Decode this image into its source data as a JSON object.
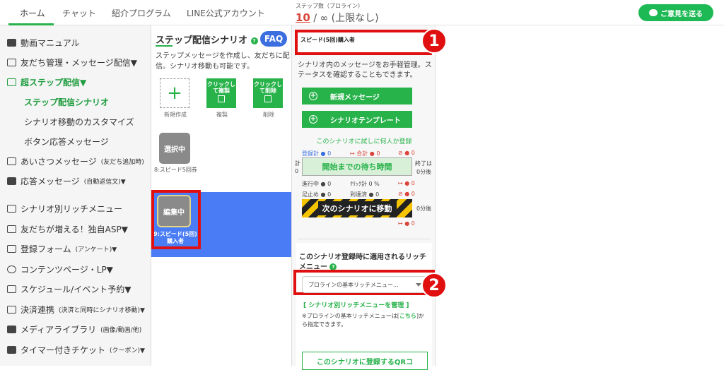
{
  "topnav": {
    "tabs": [
      "ホーム",
      "チャット",
      "紹介プログラム",
      "LINE公式アカウント"
    ],
    "steps_label": "ステップ数（プロライン）",
    "steps_current": "10",
    "steps_rest": "/ ∞ (上限なし)",
    "feedback_label": "ご意見を送る"
  },
  "sidebar": {
    "items": [
      {
        "label": "動画マニュアル"
      },
      {
        "label": "友だち管理・メッセージ配信▼"
      },
      {
        "label": "超ステップ配信▼"
      },
      {
        "label": "ステップ配信シナリオ"
      },
      {
        "label": "シナリオ移動のカスタマイズ"
      },
      {
        "label": "ボタン応答メッセージ"
      },
      {
        "label": "あいさつメッセージ",
        "note": "(友だち追加時)"
      },
      {
        "label": "応答メッセージ",
        "note": "(自動返信文)▼"
      },
      {
        "label": "シナリオ別リッチメニュー"
      },
      {
        "label": "友だちが増える！独自ASP▼"
      },
      {
        "label": "登録フォーム",
        "note": "(アンケート)▼"
      },
      {
        "label": "コンテンツページ・LP▼"
      },
      {
        "label": "スケジュール/イベント予約▼"
      },
      {
        "label": "決済連携",
        "note": "(決済と同時にシナリオ移動)▼"
      },
      {
        "label": "メディアライブラリ",
        "note": "(画像/動画/他)"
      },
      {
        "label": "タイマー付きチケット",
        "note": "(クーポン)▼"
      }
    ]
  },
  "scenario_panel": {
    "title": "ステップ配信シナリオ",
    "help": "?",
    "faq": "FAQ",
    "description": "ステップメッセージを作成し、友だちに配信。シナリオ移動も可能です。",
    "new_caption": "新規作成",
    "copy_btn": "クリックして複製",
    "copy_caption": "複製",
    "delete_btn": "クリックして削除",
    "delete_caption": "削除",
    "tile1_label": "選択中",
    "tile1_caption": "8:スピード5回券",
    "tile2_label": "編集中",
    "tile2_caption": "9:スピード(5回)購入者"
  },
  "detail_panel": {
    "scenario_name": "スピード(5回)購入者",
    "description": "シナリオ内のメッセージをお手軽管理。ステータスを確認することもできます。",
    "new_message": "新規メッセージ",
    "template": "シナリオテンプレート",
    "trial": "このシナリオに試しに何人か登録",
    "stats": {
      "registered": "登録計",
      "total": "合計",
      "count0": "0",
      "in_progress": "進行中",
      "click_total": "ｸﾘｯｸ計",
      "click_pct": "0 %",
      "stopped": "足止め",
      "reached": "到達済",
      "total_left": "計",
      "zero": "0",
      "end_label": "終了は",
      "after0": "0分後",
      "after0b": "0分後"
    },
    "wait_label": "開始までの待ち時間",
    "next_label": "次のシナリオに移動",
    "richmenu_title": "このシナリオ登録時に適用されるリッチメニュー",
    "richmenu_help": "?",
    "richmenu_select": "プロラインの基本リッチメニュー...",
    "manage_link": "[ シナリオ別リッチメニューを管理 ]",
    "note_prefix": "※プロラインの基本リッチメニューは[",
    "note_link": "こちら",
    "note_suffix": "]から指定できます。",
    "qr_btn": "このシナリオに登録するQRコ"
  },
  "badges": {
    "one": "1",
    "two": "2"
  },
  "colors": {
    "green": "#27b24a",
    "red": "#e01010",
    "blue": "#4a7df5"
  }
}
